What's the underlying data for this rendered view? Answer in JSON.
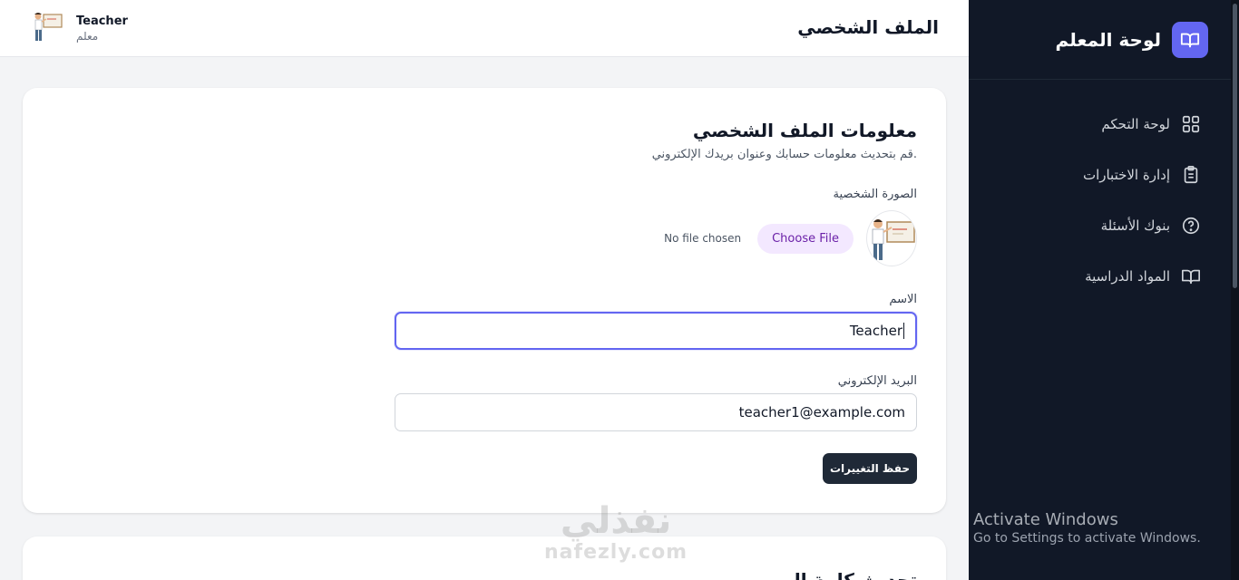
{
  "header": {
    "page_title": "الملف الشخصي",
    "user_name": "Teacher",
    "user_role": "معلم"
  },
  "sidebar": {
    "brand_title": "لوحة المعلم",
    "items": [
      {
        "label": "لوحة التحكم",
        "icon": "grid-icon"
      },
      {
        "label": "إدارة الاختبارات",
        "icon": "clipboard-icon"
      },
      {
        "label": "بنوك الأسئلة",
        "icon": "question-circle-icon"
      },
      {
        "label": "المواد الدراسية",
        "icon": "book-icon"
      }
    ]
  },
  "profile_card": {
    "title": "معلومات الملف الشخصي",
    "subtitle": "قم بتحديث معلومات حسابك وعنوان بريدك الإلكتروني.",
    "photo_label": "الصورة الشخصية",
    "choose_file_label": "Choose File",
    "file_status": "No file chosen",
    "name_label": "الاسم",
    "name_value": "Teacher",
    "email_label": "البريد الإلكتروني",
    "email_value": "teacher1@example.com",
    "save_label": "حفظ التغييرات"
  },
  "password_card": {
    "title": "تحديث كلمة المرور"
  },
  "watermark": {
    "windows_line1": "Activate Windows",
    "windows_line2": "Go to Settings to activate Windows.",
    "site_ar": "نفذلي",
    "site_en": "nafezly.com"
  },
  "colors": {
    "sidebar_bg": "#111827",
    "accent": "#6366f1",
    "button_dark": "#1f2937"
  }
}
